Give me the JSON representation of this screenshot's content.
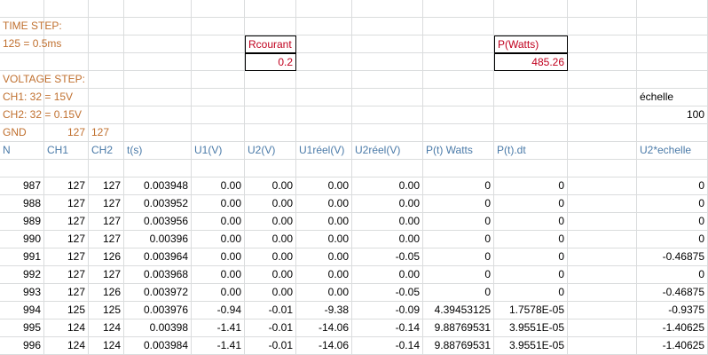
{
  "notes": {
    "time_step_label": "TIME STEP:",
    "time_step_value": "125 = 0.5ms",
    "voltage_step_label": "VOLTAGE STEP:",
    "ch1_step": "CH1:  32 = 15V",
    "ch2_step": "CH2:  32 = 0.15V",
    "gnd_label": "GND",
    "gnd_ch1": "127",
    "gnd_ch2": "127"
  },
  "rcourant": {
    "label": "Rcourant",
    "value": "0.2"
  },
  "power": {
    "label": "P(Watts)",
    "value": "485.26"
  },
  "echelle": {
    "label": "échelle",
    "value": "100"
  },
  "headers": [
    "N",
    "CH1",
    "CH2",
    "t(s)",
    "U1(V)",
    "U2(V)",
    "U1réel(V)",
    "U2réel(V)",
    "P(t) Watts",
    "P(t).dt",
    "",
    "U2*echelle"
  ],
  "rows": [
    [
      "987",
      "127",
      "127",
      "0.003948",
      "0.00",
      "0.00",
      "0.00",
      "0.00",
      "0",
      "0",
      "",
      "0"
    ],
    [
      "988",
      "127",
      "127",
      "0.003952",
      "0.00",
      "0.00",
      "0.00",
      "0.00",
      "0",
      "0",
      "",
      "0"
    ],
    [
      "989",
      "127",
      "127",
      "0.003956",
      "0.00",
      "0.00",
      "0.00",
      "0.00",
      "0",
      "0",
      "",
      "0"
    ],
    [
      "990",
      "127",
      "127",
      "0.00396",
      "0.00",
      "0.00",
      "0.00",
      "0.00",
      "0",
      "0",
      "",
      "0"
    ],
    [
      "991",
      "127",
      "126",
      "0.003964",
      "0.00",
      "0.00",
      "0.00",
      "-0.05",
      "0",
      "0",
      "",
      "-0.46875"
    ],
    [
      "992",
      "127",
      "127",
      "0.003968",
      "0.00",
      "0.00",
      "0.00",
      "0.00",
      "0",
      "0",
      "",
      "0"
    ],
    [
      "993",
      "127",
      "126",
      "0.003972",
      "0.00",
      "0.00",
      "0.00",
      "-0.05",
      "0",
      "0",
      "",
      "-0.46875"
    ],
    [
      "994",
      "125",
      "125",
      "0.003976",
      "-0.94",
      "-0.01",
      "-9.38",
      "-0.09",
      "4.39453125",
      "1.7578E-05",
      "",
      "-0.9375"
    ],
    [
      "995",
      "124",
      "124",
      "0.00398",
      "-1.41",
      "-0.01",
      "-14.06",
      "-0.14",
      "9.88769531",
      "3.9551E-05",
      "",
      "-1.40625"
    ],
    [
      "996",
      "124",
      "124",
      "0.003984",
      "-1.41",
      "-0.01",
      "-14.06",
      "-0.14",
      "9.88769531",
      "3.9551E-05",
      "",
      "-1.40625"
    ]
  ],
  "colors": {
    "note_text": "#c0702f",
    "header_text": "#4a7aa8",
    "power_value": "#c0001e",
    "gridline": "#dadcdd"
  }
}
